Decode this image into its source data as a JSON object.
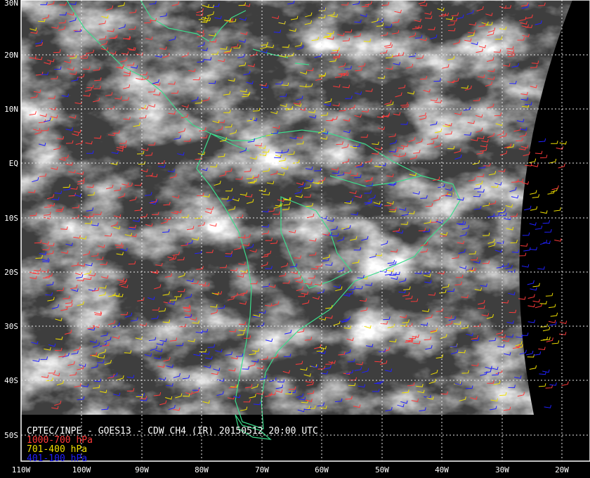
{
  "title": "CPTEC/INPE - GOES13 - CDW CH4 (IR) 20150512 20:00 UTC",
  "legend": [
    {
      "label": "1000-700 hPa",
      "color": "#ff3a3a"
    },
    {
      "label": "701-400 hPa",
      "color": "#f0e000"
    },
    {
      "label": "401-100 hPa",
      "color": "#2020ff"
    }
  ],
  "lat_labels": [
    "30N",
    "20N",
    "10N",
    "EQ",
    "10S",
    "20S",
    "30S",
    "40S",
    "50S"
  ],
  "lon_labels": [
    "110W",
    "100W",
    "90W",
    "80W",
    "70W",
    "60W",
    "50W",
    "40W",
    "30W",
    "20W"
  ],
  "colors": {
    "coastline": "#3ddc8c",
    "grid": "#e8e8e8",
    "frame": "#ffffff",
    "background": "#000000"
  }
}
